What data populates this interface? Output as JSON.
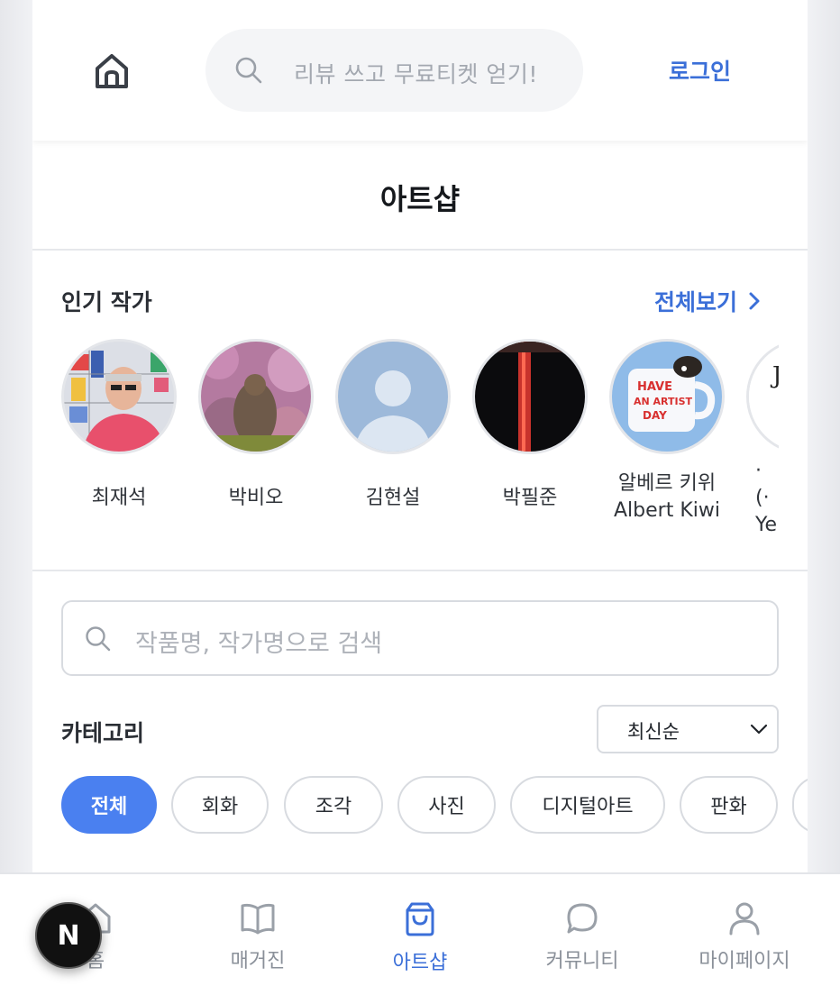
{
  "header": {
    "search_placeholder": "리뷰 쓰고 무료티켓 얻기!",
    "login_label": "로그인"
  },
  "page": {
    "title": "아트샵"
  },
  "popular": {
    "title": "인기 작가",
    "see_all": "전체보기",
    "artists": [
      {
        "name": "최재석"
      },
      {
        "name": "박비오"
      },
      {
        "name": "김현설"
      },
      {
        "name": "박필준"
      },
      {
        "name": "알베르 키위\nAlbert Kiwi",
        "name_line1": "알베르 키위",
        "name_line2": "Albert Kiwi"
      },
      {
        "name_line1": "·",
        "name_line2": "(·",
        "name_line3": "Ye"
      }
    ]
  },
  "art_search": {
    "placeholder": "작품명, 작가명으로 검색"
  },
  "category": {
    "title": "카테고리",
    "sort_selected": "최신순",
    "chips": [
      "전체",
      "회화",
      "조각",
      "사진",
      "디지털아트",
      "판화"
    ],
    "active_chip": "전체"
  },
  "bottom_nav": {
    "items": [
      {
        "label": "홈",
        "icon": "home-icon"
      },
      {
        "label": "매거진",
        "icon": "book-icon"
      },
      {
        "label": "아트샵",
        "icon": "shopping-bag-icon"
      },
      {
        "label": "커뮤니티",
        "icon": "chat-bubble-icon"
      },
      {
        "label": "마이페이지",
        "icon": "user-icon"
      }
    ],
    "active": "아트샵"
  },
  "floating_badge": {
    "label": "N"
  },
  "colors": {
    "accent": "#3b6fd8",
    "chip_active": "#4a80f0",
    "muted_text": "#8a9099"
  }
}
